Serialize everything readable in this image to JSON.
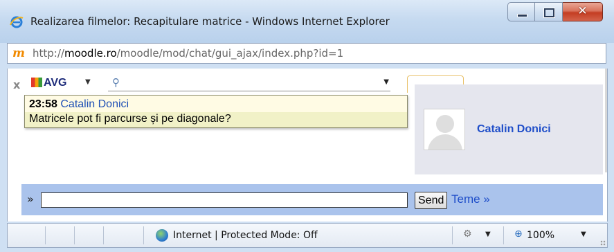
{
  "window": {
    "title": "Realizarea filmelor: Recapitulare matrice - Windows Internet Explorer"
  },
  "address": {
    "url_prefix": "http://",
    "url_domain": "moodle.ro",
    "url_path": "/moodle/mod/chat/gui_ajax/index.php?id=1"
  },
  "toolbar": {
    "close_label": "x",
    "avg_label": "AVG"
  },
  "chat": {
    "messages": [
      {
        "time": "23:58",
        "user": "Catalin Donici",
        "text": "Matricele pot fi parcurse și pe diagonale?"
      }
    ]
  },
  "user_panel": {
    "name": "Catalin Donici"
  },
  "send_bar": {
    "prompt": "»",
    "input_value": "",
    "send_label": "Send",
    "themes_link": "Teme »"
  },
  "status_bar": {
    "zone_text": "Internet | Protected Mode: Off",
    "zoom": "100%"
  }
}
